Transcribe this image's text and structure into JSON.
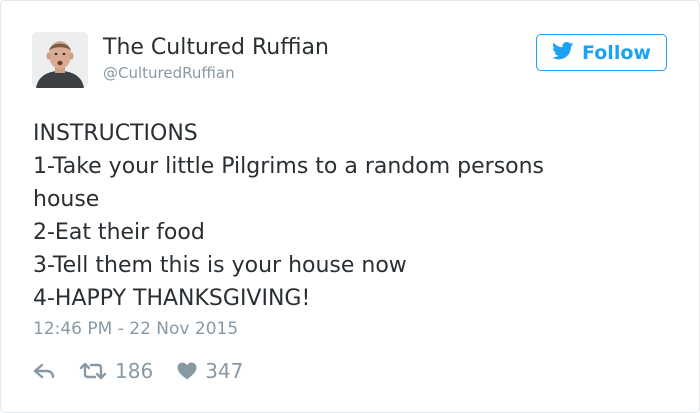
{
  "author": {
    "display_name": "The Cultured Ruffian",
    "handle": "@CulturedRuffian"
  },
  "follow_button": {
    "label": "Follow",
    "icon": "twitter-bird-icon",
    "color": "#1da1f2"
  },
  "tweet": {
    "lines": [
      "INSTRUCTIONS",
      "1-Take your little Pilgrims to a random persons",
      "house",
      "2-Eat their food",
      "3-Tell them this is your house now",
      "4-HAPPY THANKSGIVING!"
    ],
    "timestamp": "12:46 PM - 22 Nov 2015"
  },
  "actions": {
    "reply_icon": "reply-icon",
    "retweet_icon": "retweet-icon",
    "retweet_count": "186",
    "like_icon": "heart-icon",
    "like_count": "347"
  },
  "colors": {
    "text": "#292f33",
    "secondary": "#8899a6",
    "border": "#e1e8ed"
  }
}
